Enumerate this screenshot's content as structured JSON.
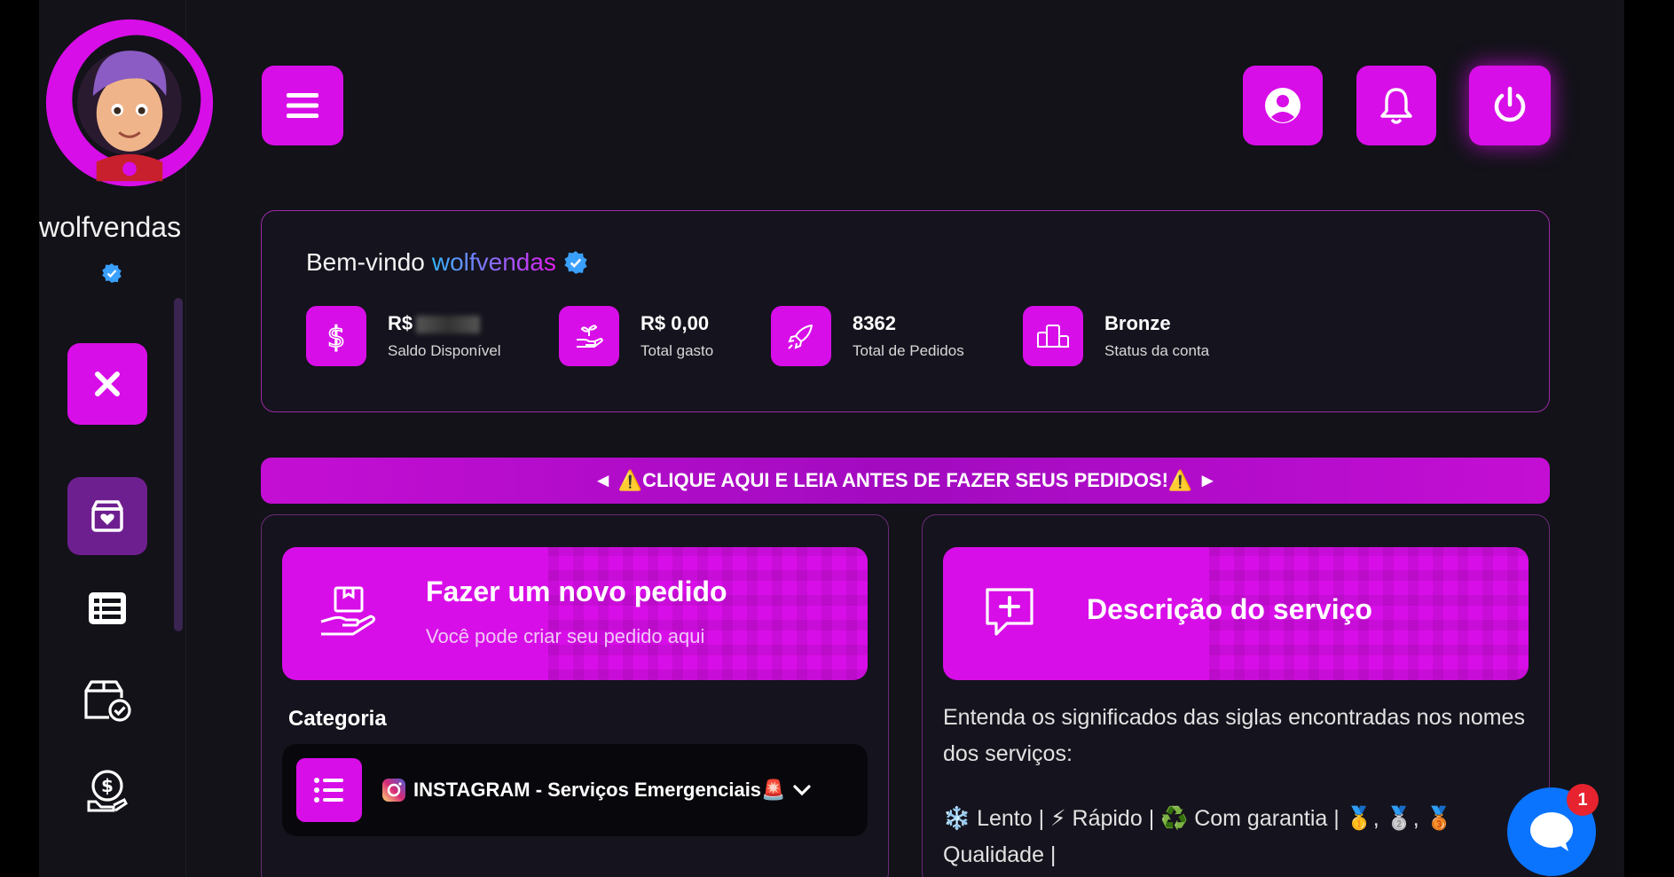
{
  "user": {
    "username": "wolfvendas"
  },
  "welcome": {
    "greeting": "Bem-vindo",
    "name": "wolfvendas",
    "stats": [
      {
        "value": "R$",
        "label": "Saldo Disponível",
        "icon": "dollar-icon"
      },
      {
        "value": "R$ 0,00",
        "label": "Total gasto",
        "icon": "hand-plant-icon"
      },
      {
        "value": "8362",
        "label": "Total de Pedidos",
        "icon": "rocket-icon"
      },
      {
        "value": "Bronze",
        "label": "Status da conta",
        "icon": "podium-icon"
      }
    ]
  },
  "notice": {
    "text": "◄ ⚠️CLIQUE AQUI E LEIA ANTES DE FAZER SEUS PEDIDOS!⚠️ ►"
  },
  "order_panel": {
    "title": "Fazer um novo pedido",
    "subtitle": "Você pode criar seu pedido aqui",
    "category_label": "Categoria",
    "category_value": "INSTAGRAM - Serviços Emergenciais🚨"
  },
  "service_panel": {
    "title": "Descrição do serviço",
    "description": "Entenda os significados das siglas encontradas nos nomes dos serviços:",
    "legend": "❄️ Lento | ⚡ Rápido | ♻️ Com garantia | 🥇, 🥈, 🥉 Qualidade |"
  },
  "chat": {
    "badge": "1"
  },
  "colors": {
    "accent": "#d80ee8",
    "background": "#121218",
    "card": "#15131d",
    "chat": "#0a74ff",
    "badge": "#e6232e"
  }
}
